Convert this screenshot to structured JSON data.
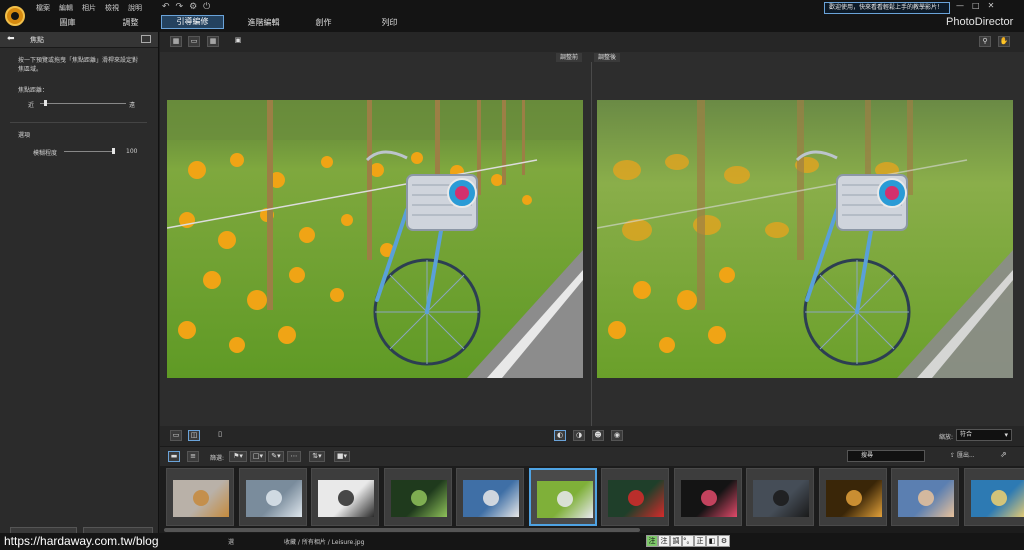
{
  "menu": [
    "檔案",
    "編輯",
    "相片",
    "檢視",
    "說明"
  ],
  "quick_icons": [
    "↶",
    "↷",
    "⚙",
    "⏻"
  ],
  "modules": {
    "library": "圖庫",
    "adjust": "調整",
    "guided": "引導編修",
    "advanced": "進階編輯",
    "create": "創作",
    "print": "列印"
  },
  "welcome": "歡迎使用，快來看看輕鬆上手的教學影片！",
  "win_controls": [
    "—",
    "□",
    "✕"
  ],
  "brand": "PhotoDirector",
  "panel": {
    "title": "焦點",
    "description": "按一下預覽或拖曳「焦點距離」滑桿來設定對焦區域。",
    "focus_label": "焦點距離：",
    "near": "近",
    "far": "遠",
    "focus_value": 0.05,
    "options_label": "選項",
    "blur_label": "模糊程度",
    "blur_value": "100",
    "reset_label": "",
    "apply_label": ""
  },
  "compare": {
    "before": "調整前",
    "after": "調整後"
  },
  "zoom": {
    "label": "縮放:",
    "value": "符合"
  },
  "filmbar": {
    "filter_label": "篩選:",
    "search_placeholder": "搜尋",
    "export_label": "匯出..."
  },
  "thumbnails": [
    {
      "bg": "#b9b1a8",
      "fg": "#c58a3c"
    },
    {
      "bg": "#7a8c9c",
      "fg": "#dfe7ee"
    },
    {
      "bg": "#e9e9e9",
      "fg": "#2a2a2a"
    },
    {
      "bg": "#1f3a1d",
      "fg": "#8fc25a"
    },
    {
      "bg": "#3f6fa6",
      "fg": "#e8e8e8"
    },
    {
      "bg": "#7fb039",
      "fg": "#e9e9f0"
    },
    {
      "bg": "#1f3f2a",
      "fg": "#d62b2b"
    },
    {
      "bg": "#141414",
      "fg": "#e14a6a"
    },
    {
      "bg": "#454d57",
      "fg": "#1a1a1a"
    },
    {
      "bg": "#3a2608",
      "fg": "#e3a13a"
    },
    {
      "bg": "#5b7fb1",
      "fg": "#e9c29b"
    },
    {
      "bg": "#2d7ab3",
      "fg": "#f0d070"
    }
  ],
  "selected_thumb_index": 5,
  "status": {
    "watermark": "https://hardaway.com.tw/blog",
    "selected": "選",
    "breadcrumb": "收藏 / 所有相片 / Leisure.jpg"
  },
  "ime": [
    "注",
    "注",
    "調",
    "°。",
    "正",
    "◧",
    "⚙"
  ]
}
